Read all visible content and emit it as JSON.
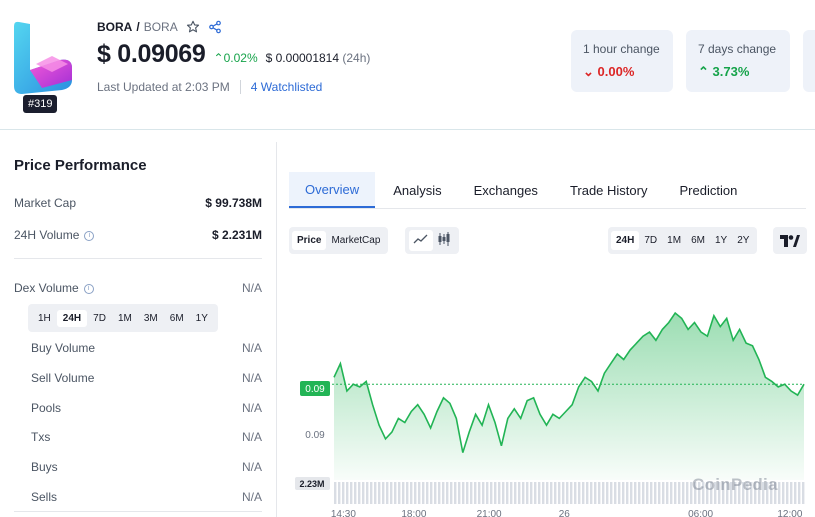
{
  "coin": {
    "symbol": "BORA",
    "pair": "BORA",
    "rank": "#319",
    "price": "$ 0.09069",
    "price_change_24h": "0.02%",
    "btc_price": "$ 0.00001814",
    "btc_period": "(24h)",
    "last_updated": "Last Updated at 2:03 PM",
    "watchlisted": "4 Watchlisted",
    "colors": {
      "logo_left": "#3ec3e8",
      "logo_right": "#e53fd1",
      "up": "#16a34a",
      "down": "#dc2626"
    }
  },
  "header_icons": [
    "star-icon",
    "share-icon"
  ],
  "changes": [
    {
      "label": "1 hour change",
      "value": "0.00%",
      "direction": "down"
    },
    {
      "label": "7 days change",
      "value": "3.73%",
      "direction": "up"
    }
  ],
  "performance": {
    "title": "Price Performance",
    "market_cap_label": "Market Cap",
    "market_cap": "$ 99.738M",
    "volume_label": "24H Volume",
    "volume": "$ 2.231M",
    "dex_label": "Dex Volume",
    "dex_value": "N/A",
    "dex_ranges": [
      "1H",
      "24H",
      "7D",
      "1M",
      "3M",
      "6M",
      "1Y"
    ],
    "dex_active_range": "24H",
    "dex_rows": [
      {
        "label": "Buy Volume",
        "value": "N/A"
      },
      {
        "label": "Sell Volume",
        "value": "N/A"
      },
      {
        "label": "Pools",
        "value": "N/A"
      },
      {
        "label": "Txs",
        "value": "N/A"
      },
      {
        "label": "Buys",
        "value": "N/A"
      },
      {
        "label": "Sells",
        "value": "N/A"
      }
    ]
  },
  "tabs": [
    "Overview",
    "Analysis",
    "Exchanges",
    "Trade History",
    "Prediction"
  ],
  "active_tab": "Overview",
  "chart_controls": {
    "modes": [
      "Price",
      "MarketCap"
    ],
    "active_mode": "Price",
    "chart_types": [
      "line-chart-icon",
      "candlestick-icon"
    ],
    "ranges": [
      "24H",
      "7D",
      "1M",
      "6M",
      "1Y",
      "2Y"
    ],
    "active_range": "24H",
    "brand_icon": "tradingview-icon"
  },
  "watermark": "CoinPedia",
  "chart_data": {
    "type": "area",
    "title": "",
    "xlabel": "",
    "ylabel": "",
    "x_ticks": [
      "14:30",
      "18:00",
      "21:00",
      "26",
      "06:00",
      "12:00"
    ],
    "y_ticks": [
      "0.09"
    ],
    "current_price_label": "0.09",
    "volume_label": "2.23M",
    "series": [
      {
        "values": [
          0.09075,
          0.09085,
          0.09065,
          0.0907,
          0.09068,
          0.09072,
          0.09055,
          0.0904,
          0.0903,
          0.09035,
          0.09045,
          0.09042,
          0.0905,
          0.09055,
          0.09048,
          0.09038,
          0.0905,
          0.0906,
          0.09056,
          0.09045,
          0.0902,
          0.09035,
          0.09048,
          0.0904,
          0.09055,
          0.09042,
          0.09025,
          0.09045,
          0.09052,
          0.09045,
          0.09058,
          0.0906,
          0.09048,
          0.0904,
          0.09048,
          0.09045,
          0.0905,
          0.09055,
          0.09068,
          0.09075,
          0.09072,
          0.09065,
          0.09078,
          0.09085,
          0.09092,
          0.09088,
          0.09095,
          0.091,
          0.09105,
          0.09108,
          0.09102,
          0.0911,
          0.09115,
          0.09122,
          0.09118,
          0.0911,
          0.09115,
          0.09108,
          0.09105,
          0.0912,
          0.09112,
          0.09118,
          0.09102,
          0.0911,
          0.091,
          0.09098,
          0.09088,
          0.09075,
          0.09072,
          0.09068,
          0.0907,
          0.09065,
          0.09062,
          0.0907
        ],
        "color": "#22b455"
      }
    ],
    "ylim": [
      0.09,
      0.0913
    ],
    "current_price": 0.0907,
    "volume_bars": "uniform",
    "grid": false
  }
}
